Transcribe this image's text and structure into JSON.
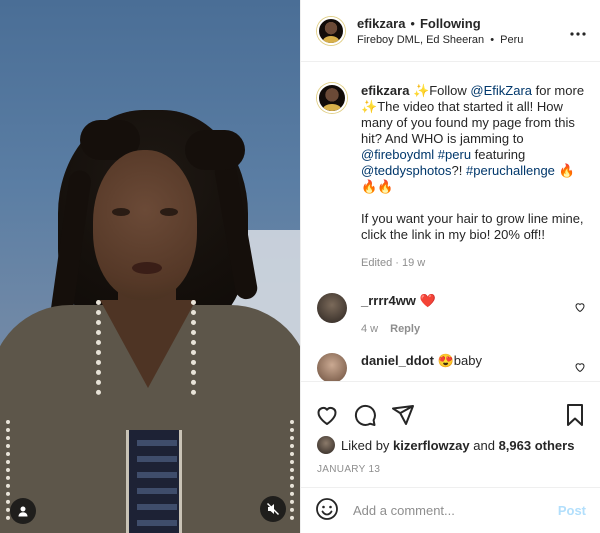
{
  "header": {
    "username": "efikzara",
    "separator": "•",
    "follow_label": "Following",
    "audio": "Fireboy DML, Ed Sheeran",
    "location_sep": "•",
    "location": "Peru",
    "more_label": "•••"
  },
  "caption": {
    "username": "efikzara",
    "sparkle1": "✨",
    "text1": "Follow ",
    "mention1": "@EfikZara",
    "text2": " for more ",
    "sparkle2": "✨",
    "text3": "The video that started it all! How many of you found my page from this hit? And WHO is jamming to ",
    "mention2": "@fireboydml",
    "text4": " ",
    "hashtag1": "#peru",
    "text5": " featuring ",
    "mention3": "@teddysphotos",
    "text6": "?! ",
    "hashtag2": "#peruchallenge",
    "fire": " 🔥🔥🔥",
    "para2": "If you want your hair to grow line mine, click the link in my bio! 20% off!!",
    "edited": "Edited",
    "meta_sep": "·",
    "age": "19 w"
  },
  "comments": [
    {
      "username": "_rrrr4ww",
      "text": " ❤️",
      "age": "4 w",
      "reply_label": "Reply"
    },
    {
      "username": "daniel_ddot",
      "text": " 😍baby",
      "age": "",
      "reply_label": ""
    }
  ],
  "likes": {
    "prefix": "Liked by ",
    "user": "kizerflowzay",
    "middle": " and ",
    "count": "8,963 others"
  },
  "date": "JANUARY 13",
  "comment_input": {
    "placeholder": "Add a comment...",
    "post_label": "Post"
  },
  "icons": [
    "user-tag-icon",
    "muted-speaker-icon",
    "emoji-icon",
    "heart-icon",
    "comment-icon",
    "share-icon",
    "bookmark-icon",
    "more-options-icon"
  ],
  "colors": {
    "link": "#00376b",
    "muted": "#8e8e8e",
    "post_disabled": "#b2dffc",
    "heart_red": "#ed4956"
  }
}
